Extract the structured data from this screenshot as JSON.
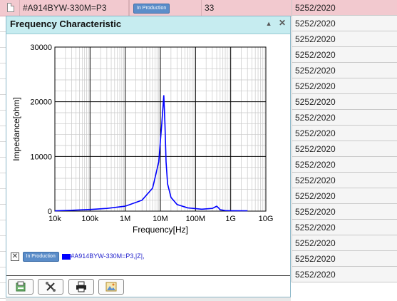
{
  "top_row": {
    "part_number": "#A914BYW-330M=P3",
    "status_badge": "In Production",
    "quantity": "33",
    "date_code": "5252/2020"
  },
  "right_column": {
    "rows": [
      "5252/2020",
      "5252/2020",
      "5252/2020",
      "5252/2020",
      "5252/2020",
      "5252/2020",
      "5252/2020",
      "5252/2020",
      "5252/2020",
      "5252/2020",
      "5252/2020",
      "5252/2020",
      "5252/2020",
      "5252/2020",
      "5252/2020",
      "5252/2020",
      "5252/2020",
      "5252/2020"
    ]
  },
  "dialog": {
    "title": "Frequency Characteristic",
    "collapse_glyph": "▲",
    "close_glyph": "✕"
  },
  "chart_data": {
    "type": "line",
    "title": "",
    "xlabel": "Frequency[Hz]",
    "ylabel": "Impedance[ohm]",
    "x_scale": "log",
    "xlim": [
      10000,
      10000000000
    ],
    "ylim": [
      0,
      30000
    ],
    "x_ticks": [
      "10k",
      "100k",
      "1M",
      "10M",
      "100M",
      "1G",
      "10G"
    ],
    "y_ticks": [
      "0",
      "10000",
      "20000",
      "30000"
    ],
    "grid": true,
    "series": [
      {
        "name": "#A914BYW-330M=P3,|Z|,",
        "color": "#0000ff",
        "x": [
          10000,
          30000,
          100000,
          300000,
          1000000,
          3000000,
          6000000,
          9000000,
          11000000,
          12500000,
          13500000,
          14500000,
          16000000,
          20000000,
          30000000,
          60000000,
          150000000,
          300000000,
          400000000,
          450000000,
          500000000,
          700000000,
          1000000000,
          3000000000
        ],
        "y": [
          50,
          150,
          300,
          500,
          900,
          2000,
          4200,
          9000,
          16000,
          21200,
          16000,
          9000,
          5000,
          2500,
          1200,
          600,
          350,
          500,
          900,
          600,
          250,
          100,
          80,
          60
        ]
      }
    ]
  },
  "legend": {
    "checkbox_glyph": "✕",
    "status_badge": "In Production",
    "series_label": "#A914BYW-330M=P3,|Z|,"
  },
  "toolbar": {
    "buttons": [
      {
        "name": "export-icon"
      },
      {
        "name": "tools-icon"
      },
      {
        "name": "print-icon"
      },
      {
        "name": "image-icon"
      }
    ]
  }
}
